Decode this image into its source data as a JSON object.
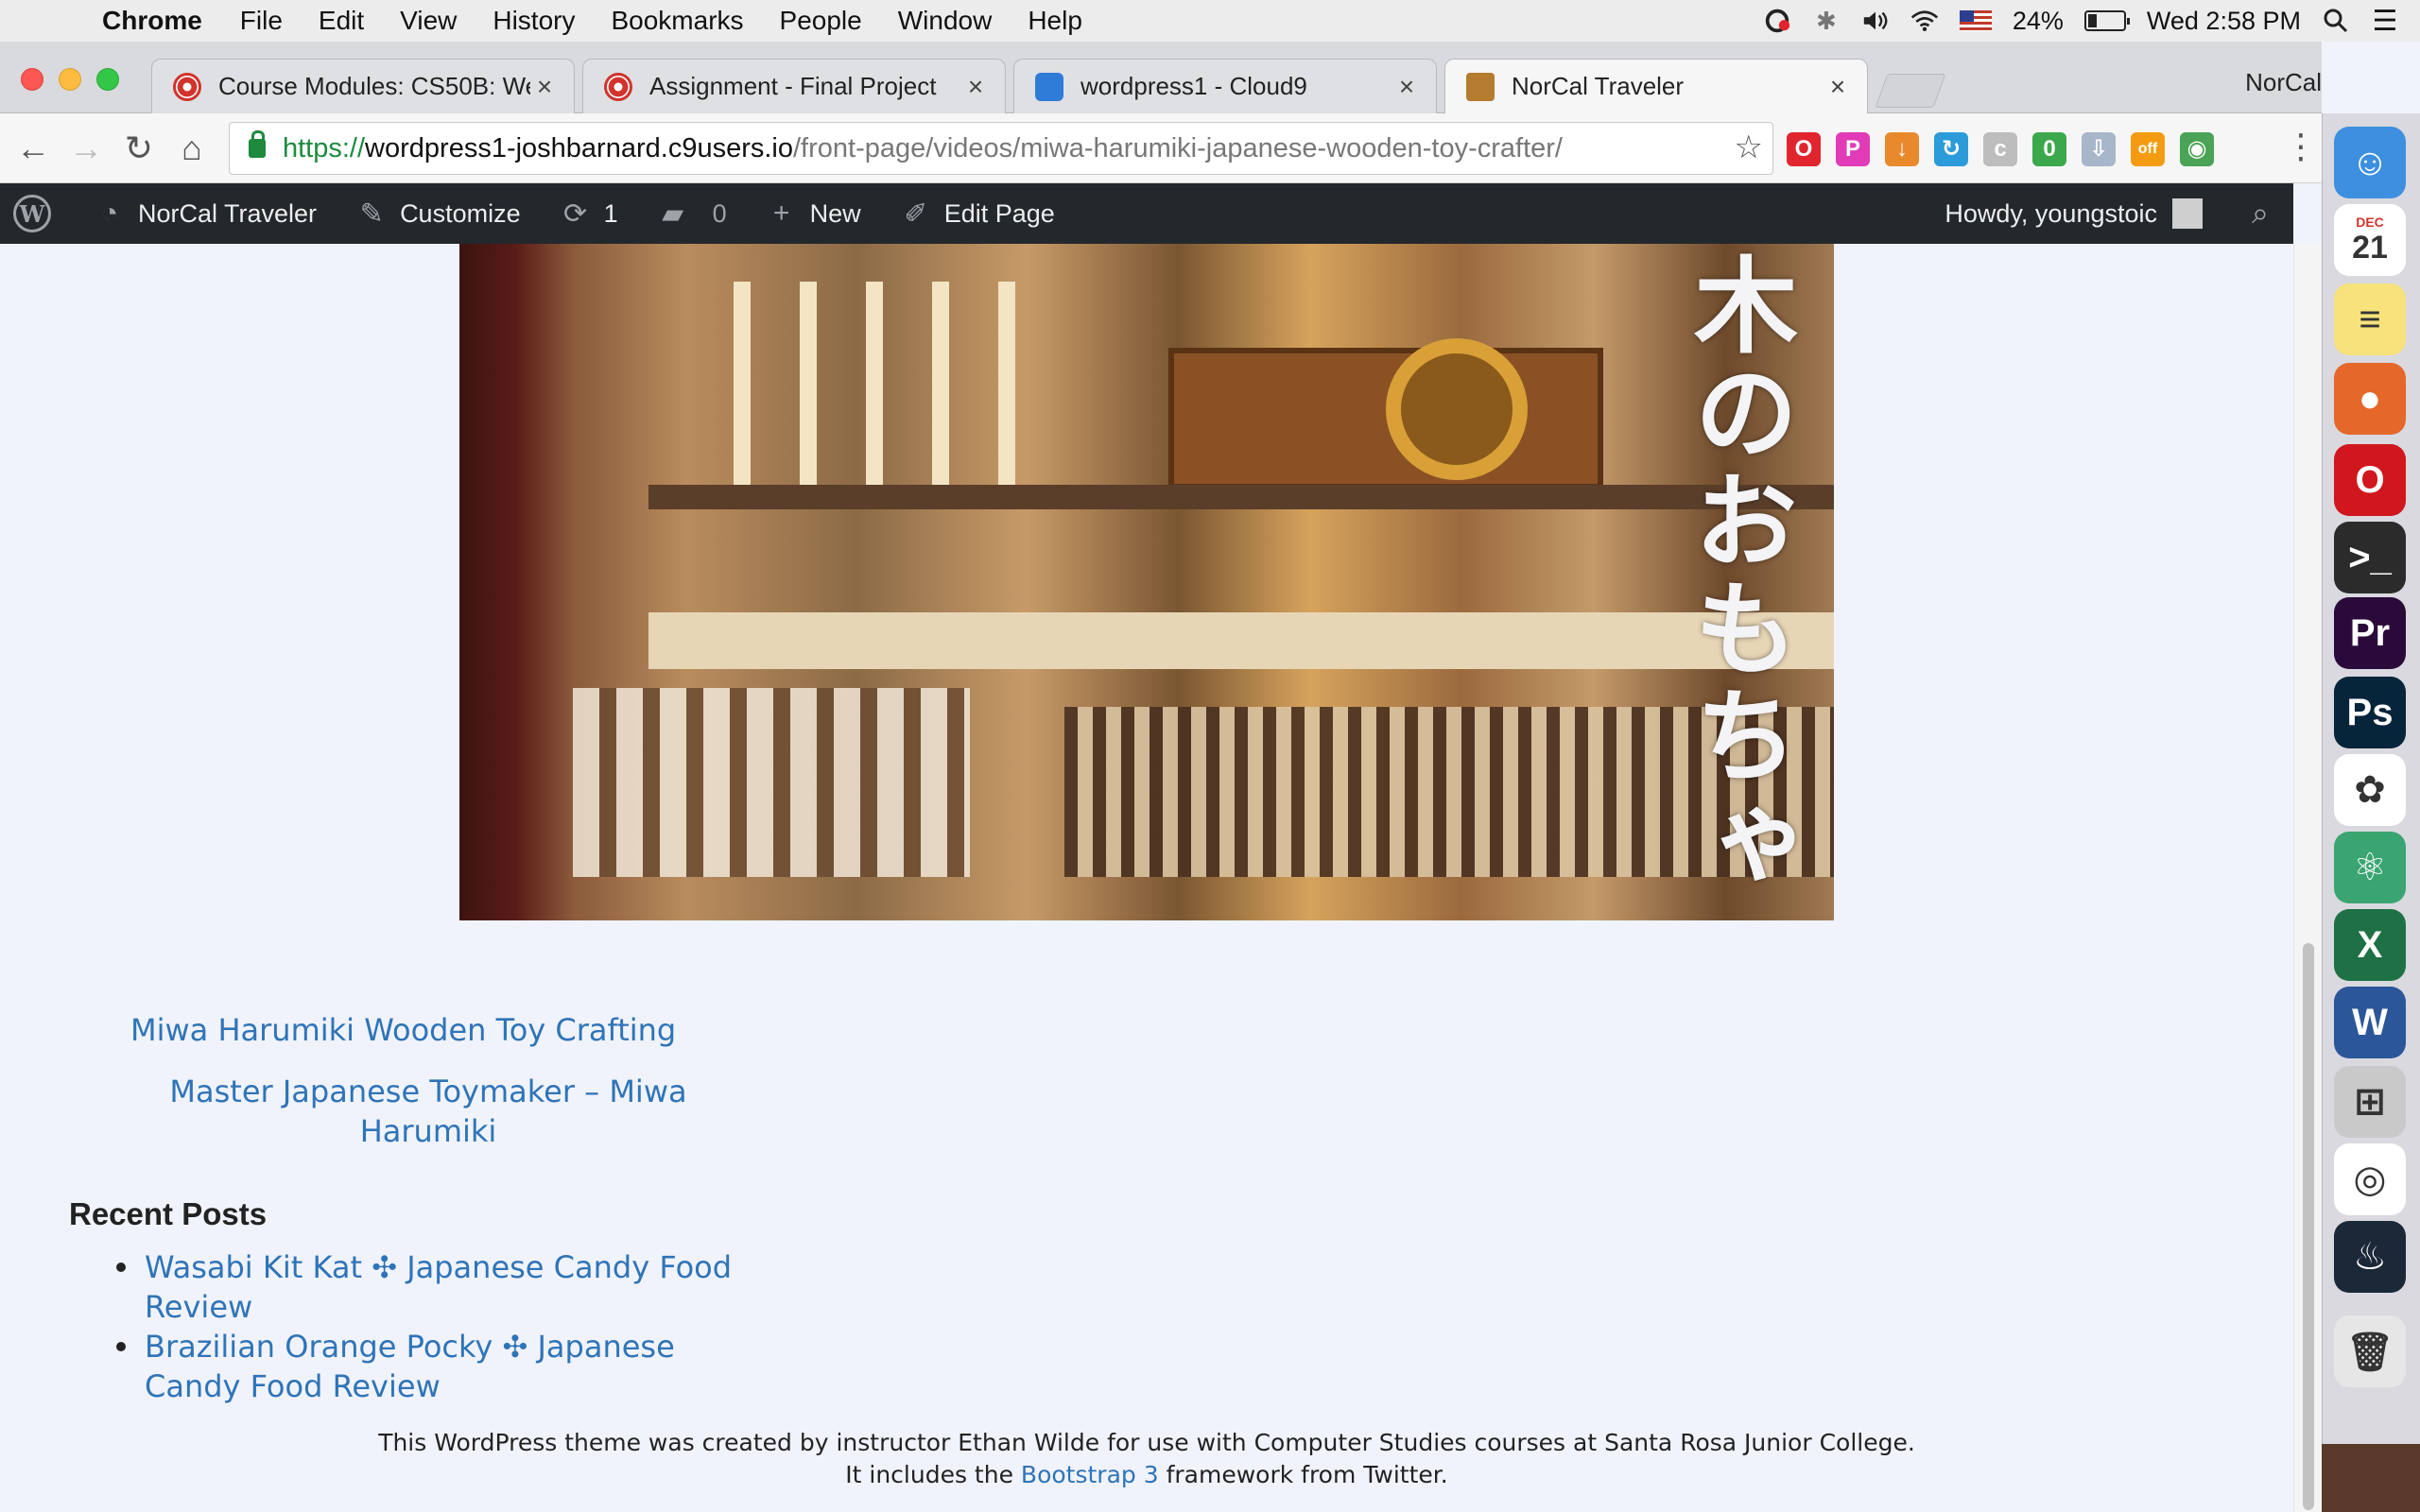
{
  "menubar": {
    "app_name": "Chrome",
    "items": [
      "File",
      "Edit",
      "View",
      "History",
      "Bookmarks",
      "People",
      "Window",
      "Help"
    ],
    "battery": "24%",
    "battery_level": 0.24,
    "clock": "Wed 2:58 PM"
  },
  "tabs": [
    {
      "title": "Course Modules: CS50B: Web",
      "favicon": "canvas-icon"
    },
    {
      "title": "Assignment - Final Project",
      "favicon": "canvas-icon"
    },
    {
      "title": "wordpress1 - Cloud9",
      "favicon": "cloud9-icon"
    },
    {
      "title": "NorCal Traveler",
      "favicon": "suitcase-icon",
      "active": true
    }
  ],
  "profile_name": "NorCal",
  "address": {
    "scheme": "https://",
    "host": "wordpress1-joshbarnard.c9users.io",
    "path": "/front-page/videos/miwa-harumiki-japanese-wooden-toy-crafter/"
  },
  "extensions": [
    {
      "name": "opera-icon",
      "color": "#e1252e",
      "glyph": "O"
    },
    {
      "name": "pen-icon",
      "color": "#e23bb7",
      "glyph": "P"
    },
    {
      "name": "download-icon",
      "color": "#e8892c",
      "glyph": "↓"
    },
    {
      "name": "sync-icon",
      "color": "#2b9bd9",
      "glyph": "↻"
    },
    {
      "name": "css-icon",
      "color": "#bdbdbd",
      "glyph": "c"
    },
    {
      "name": "badge-icon",
      "color": "#3ba84b",
      "glyph": "0"
    },
    {
      "name": "arrow-down-icon",
      "color": "#a7b6c9",
      "glyph": "⇩"
    },
    {
      "name": "off-icon",
      "color": "#f39c12",
      "glyph": "off"
    },
    {
      "name": "globe-icon",
      "color": "#4aa356",
      "glyph": "◉"
    }
  ],
  "adminbar": {
    "site_name": "NorCal Traveler",
    "customize": "Customize",
    "updates_count": "1",
    "comments_count": "0",
    "new_label": "New",
    "edit_label": "Edit Page",
    "howdy": "Howdy, youngstoic"
  },
  "video": {
    "caption": "木のおもちゃ"
  },
  "content": {
    "video_title": "Miwa Harumiki Wooden Toy Crafting",
    "video_subtitle": "Master Japanese Toymaker – Miwa Harumiki",
    "recent_heading": "Recent Posts",
    "recent_posts": [
      "Wasabi Kit Kat ✣ Japanese Candy Food Review",
      "Brazilian Orange Pocky ✣ Japanese Candy Food Review"
    ]
  },
  "footer": {
    "line1": "This WordPress theme was created by instructor Ethan Wilde for use with Computer Studies courses at Santa Rosa Junior College.",
    "line2_before": "It includes the ",
    "line2_link": "Bootstrap 3",
    "line2_after": " framework from Twitter."
  },
  "dock": [
    {
      "name": "finder-icon",
      "color": "#3d8fe0",
      "glyph": "☺"
    },
    {
      "name": "calendar-icon",
      "color": "#ffffff",
      "glyph": "21",
      "sub": "DEC"
    },
    {
      "name": "notes-icon",
      "color": "#f7e27b",
      "glyph": "≡"
    },
    {
      "name": "firefox-icon",
      "color": "#e5672a",
      "glyph": "●"
    },
    {
      "name": "opera-browser-icon",
      "color": "#d0171d",
      "glyph": "O"
    },
    {
      "name": "terminal-icon",
      "color": "#2b2b2b",
      "glyph": ">_"
    },
    {
      "name": "premiere-icon",
      "color": "#2a0a3a",
      "glyph": "Pr"
    },
    {
      "name": "photoshop-icon",
      "color": "#06243a",
      "glyph": "Ps"
    },
    {
      "name": "photos-icon",
      "color": "#ffffff",
      "glyph": "✿"
    },
    {
      "name": "atom-icon",
      "color": "#3aa571",
      "glyph": "⚛"
    },
    {
      "name": "excel-icon",
      "color": "#1e7145",
      "glyph": "X"
    },
    {
      "name": "word-icon",
      "color": "#2b579a",
      "glyph": "W"
    },
    {
      "name": "calculator-icon",
      "color": "#c9c9c9",
      "glyph": "⊞"
    },
    {
      "name": "chrome-icon",
      "color": "#ffffff",
      "glyph": "◎"
    },
    {
      "name": "steam-icon",
      "color": "#1b2838",
      "glyph": "♨"
    },
    {
      "name": "trash-icon",
      "color": "#e6e6e6",
      "glyph": "🗑"
    }
  ]
}
